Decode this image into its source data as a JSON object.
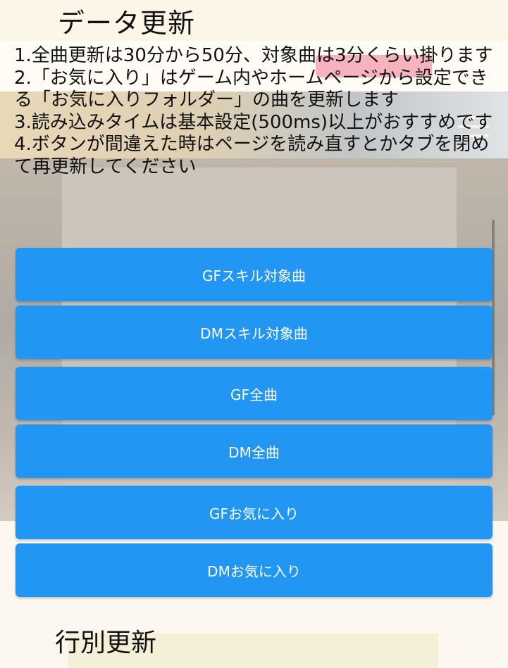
{
  "header": {
    "title": "データ更新"
  },
  "notes": [
    "1.全曲更新は30分から50分、対象曲は3分くらい掛ります",
    "2.「お気に入り」はゲーム内やホームページから設定できる「お気に入りフォルダー」の曲を更新します",
    "3.読み込みタイムは基本設定(500ms)以上がおすすめです",
    "4.ボタンが間違えた時はページを読み直すとかタブを閉めて再更新してください"
  ],
  "buttons": [
    {
      "label": "GFスキル対象曲"
    },
    {
      "label": "DMスキル対象曲"
    },
    {
      "label": "GF全曲"
    },
    {
      "label": "DM全曲"
    },
    {
      "label": "GFお気に入り"
    },
    {
      "label": "DMお気に入り"
    }
  ],
  "section2": {
    "title": "行別更新"
  },
  "colors": {
    "button_bg": "#2196f3",
    "button_text": "#ffffff",
    "title_bar": "#fdf6e8"
  }
}
